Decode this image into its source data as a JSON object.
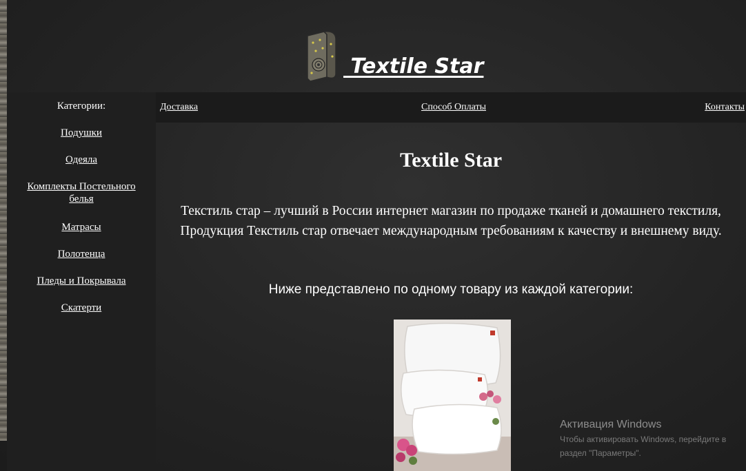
{
  "header": {
    "logo_text": " Textile Star",
    "logo_icon": "fabric-roll-icon"
  },
  "nav": {
    "links": [
      "Доставка",
      "Способ Оплаты",
      "Контакты"
    ]
  },
  "sidebar": {
    "title": "Категории:",
    "items": [
      {
        "label": "Подушки"
      },
      {
        "label": "Одеяла"
      },
      {
        "label_line1": "Комплекты Постельного",
        "label_line2": "белья"
      },
      {
        "label": "Матрасы"
      },
      {
        "label": "Полотенца"
      },
      {
        "label": "Пледы и Покрывала"
      },
      {
        "label": "Скатерти"
      }
    ]
  },
  "main": {
    "title": "Textile Star",
    "intro_line1": "Текстиль стар – лучший в России интернет магазин по продаже тканей и домашнего текстиля,",
    "intro_line2": "Продукция Текстиль стар отвечает международным требованиям к качеству и внешнему виду.",
    "subheading": "Ниже представлено по одному товару из каждой категории:",
    "product_image": "pillows-product-image"
  },
  "watermark": {
    "title": "Активация Windows",
    "line1": "Чтобы активировать Windows, перейдите в",
    "line2": "раздел \"Параметры\"."
  },
  "colors": {
    "background": "#232323",
    "nav_background": "#1b1b1b",
    "sidebar_background": "#1f1f1f",
    "text": "#ffffff"
  }
}
